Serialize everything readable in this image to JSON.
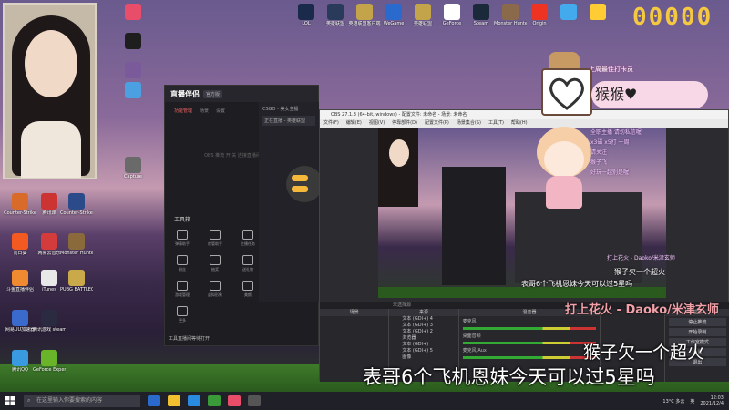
{
  "score": "00000",
  "desktop_icons": [
    {
      "label": "",
      "color": "#e84d6a"
    },
    {
      "label": "",
      "color": "#1e1e1e"
    },
    {
      "label": "",
      "color": "#7a5a9a"
    },
    {
      "label": "",
      "color": "#4aa0e0"
    },
    {
      "label": "Counter-Strike",
      "color": "#d86a2a"
    },
    {
      "label": "腾讯课",
      "color": "#cc3333"
    },
    {
      "label": "Counter-Strike: Global Of...",
      "color": "#2a4a8a"
    },
    {
      "label": "向日葵",
      "color": "#f25a22"
    },
    {
      "label": "网易云音乐",
      "color": "#d43c3c"
    },
    {
      "label": "Monster Hunter...",
      "color": "#8a6a3a"
    },
    {
      "label": "斗鱼直播伴侣",
      "color": "#f08a30"
    },
    {
      "label": "iTunes",
      "color": "#e8e8e8"
    },
    {
      "label": "PUBG BATTLEGR...",
      "color": "#c9a94a"
    },
    {
      "label": "网易UU加速器",
      "color": "#3a6acc"
    },
    {
      "label": "腾讯游戏 steam游戏",
      "color": "#2a2a40"
    },
    {
      "label": "腾讯QQ",
      "color": "#3a9ae0"
    },
    {
      "label": "GeForce Experience",
      "color": "#6ab42a"
    },
    {
      "label": "Capture",
      "color": "#6a6a6a"
    }
  ],
  "top_icons": [
    {
      "label": "LOL",
      "color": "#1a2a4a"
    },
    {
      "label": "英雄联盟",
      "color": "#2a3a5a"
    },
    {
      "label": "英雄联盟客户端",
      "color": "#c4a44a"
    },
    {
      "label": "WeGame",
      "color": "#2a6acc"
    },
    {
      "label": "英雄联盟",
      "color": "#c4a44a"
    },
    {
      "label": "GeForce",
      "color": "#fff"
    },
    {
      "label": "Steam",
      "color": "#1a2a3a"
    },
    {
      "label": "Monster Hunter",
      "color": "#8a6a4a"
    },
    {
      "label": "Origin",
      "color": "#ee3322"
    },
    {
      "label": "",
      "color": "#44aaee"
    },
    {
      "label": "",
      "color": "#ffcc33"
    }
  ],
  "stream_app": {
    "name": "直播伴侣",
    "tag": "官方版",
    "tabs": [
      "功能管理",
      "场景",
      "设置"
    ],
    "empty_tip": "OBS 推流 开 关 连接直播间开启直播",
    "tools_title": "工具箱",
    "tools": [
      "弹幕助手",
      "房管助手",
      "主播任务",
      "礼物",
      "粉丝",
      "抽奖",
      "送礼物",
      "直播设置",
      "游戏管理",
      "虚拟形象",
      "美颜",
      "音效",
      "更多"
    ],
    "footer": "工具直播间等待打开",
    "side_title": "CSGO - 美女主播",
    "side_item": "正在直播 - 英雄联盟"
  },
  "obs": {
    "title": "OBS 27.1.3 (64-bit, windows) - 配置文件: 未命名 - 场景: 未命名",
    "menu": [
      "文件(F)",
      "编辑(E)",
      "视图(V)",
      "停靠部件(D)",
      "配置文件(P)",
      "场景集合(S)",
      "工具(T)",
      "帮助(H)"
    ],
    "status_bar": "未选择源",
    "scenes_title": "场景",
    "sources_title": "来源",
    "mixer_title": "混音器",
    "controls_title": "控件",
    "sources": [
      "文本 (GDI+) 4",
      "文本 (GDI+) 3",
      "文本 (GDI+) 2",
      "浏览器",
      "文本 (GDI+)",
      "文本 (GDI+) 5",
      "图像"
    ],
    "mixer": [
      "麦克风",
      "桌面音频",
      "麦克风/Aux"
    ],
    "controls": [
      "停止推流",
      "开始录制",
      "工作室模式",
      "设置",
      "退出"
    ]
  },
  "overlay": {
    "card_top": "上周最佳打卡员",
    "card_name": "猴猴♥",
    "tips": [
      "全职主播 请勿私信喔",
      "x3磁 x5打 一周",
      "请关注",
      "猴子飞",
      "好玩一起别是喔"
    ],
    "song": "打上花火 - Daoko/米津玄师",
    "sub1": "猴子欠一个超火",
    "sub2": "表哥6个飞机恩妹今天可以过5星吗",
    "mini_title": "打上花火 - Daoko/米津玄师",
    "mini1": "猴子欠一个超火",
    "mini2": "表哥6个飞机恩妹今天可以过5星吗"
  },
  "taskbar": {
    "search": "在这里输入你要搜索的内容",
    "temp": "13°C 多云",
    "lang": "英",
    "time": "12:03",
    "date": "2021/12/4"
  }
}
